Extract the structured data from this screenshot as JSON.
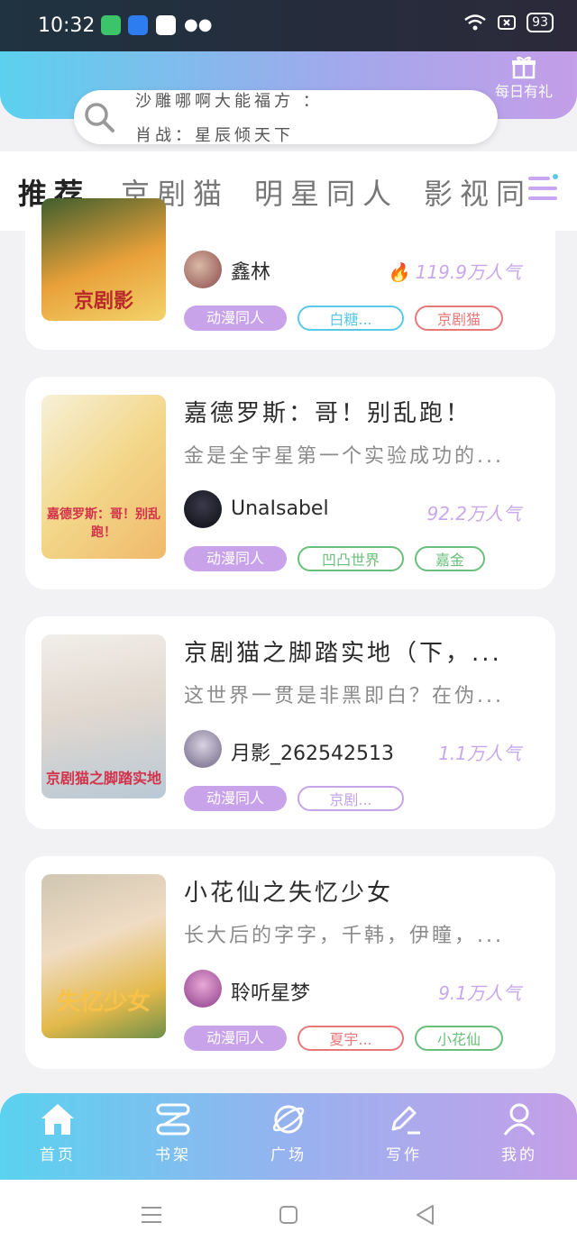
{
  "status_bar": {
    "time": "10:32",
    "battery": "93"
  },
  "header": {
    "daily_gift_label": "每日有礼"
  },
  "search": {
    "line1": "沙雕哪啊大能福方 ：",
    "line2": "肖战：星辰倾天下"
  },
  "tabs": [
    {
      "label": "推荐",
      "active": true
    },
    {
      "label": "京剧猫",
      "active": false
    },
    {
      "label": "明星同人",
      "active": false
    },
    {
      "label": "影视同",
      "active": false
    }
  ],
  "cards": [
    {
      "author": "鑫林",
      "heat": "119.9万人气",
      "tags": [
        "动漫同人",
        "白糖...",
        "京剧猫"
      ]
    },
    {
      "title": "嘉德罗斯：哥！别乱跑！",
      "description": "金是全宇星第一个实验成功的...",
      "cover_text": "嘉德罗斯：哥！别乱跑！",
      "author": "UnaIsabel",
      "heat": "92.2万人气",
      "tags": [
        "动漫同人",
        "凹凸世界",
        "嘉金"
      ]
    },
    {
      "title": "京剧猫之脚踏实地（下，...",
      "description": "这世界一贯是非黑即白？在伪...",
      "cover_text": "京剧猫之脚踏实地",
      "author": "月影_262542513",
      "heat": "1.1万人气",
      "tags": [
        "动漫同人",
        "京剧..."
      ]
    },
    {
      "title": "小花仙之失忆少女",
      "description": "长大后的字字，千韩，伊瞳，...",
      "cover_text": "失忆少女",
      "author": "聆听星梦",
      "heat": "9.1万人气",
      "tags": [
        "动漫同人",
        "夏宇...",
        "小花仙"
      ]
    }
  ],
  "bottom_nav": [
    {
      "label": "首页",
      "icon": "home-icon"
    },
    {
      "label": "书架",
      "icon": "bookshelf-icon"
    },
    {
      "label": "广场",
      "icon": "planet-icon"
    },
    {
      "label": "写作",
      "icon": "pen-icon"
    },
    {
      "label": "我的",
      "icon": "profile-icon"
    }
  ],
  "colors": {
    "accent_purple": "#c9a3ea",
    "tag_blue": "#5bc8e8",
    "tag_red": "#e8787a",
    "tag_green": "#6abf7a",
    "tag_purple": "#c6a4ea"
  }
}
